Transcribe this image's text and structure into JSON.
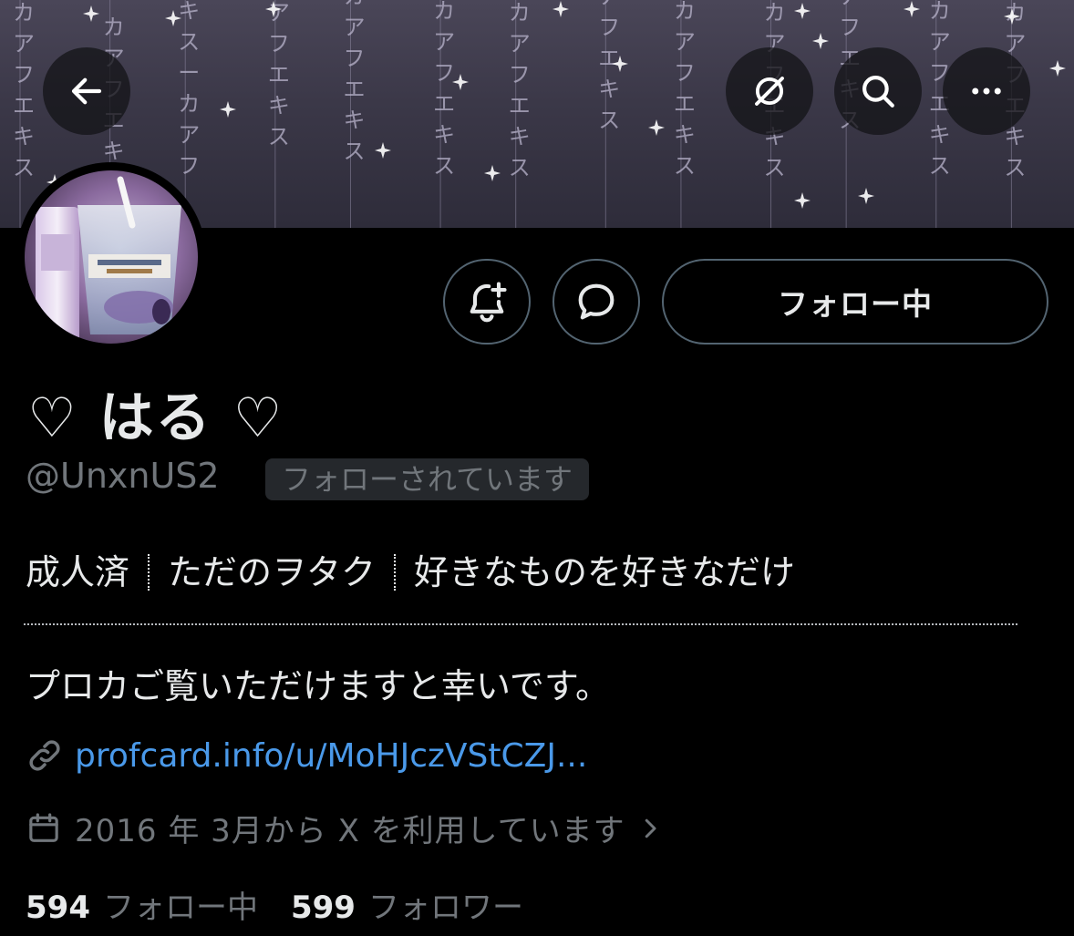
{
  "profile": {
    "display_name": "♡ はる ♡",
    "handle": "@UnxnUS2",
    "follows_you_badge": "フォローされています",
    "following_button_label": "フォロー中",
    "bio": {
      "tags": [
        "成人済",
        "ただのヲタク",
        "好きなものを好きなだけ"
      ],
      "text": "プロカご覧いただけますと幸いです。"
    },
    "link": "profcard.info/u/MoHJczVStCZJ...",
    "joined": "2016 年 3月から X を利用しています",
    "stats": {
      "following_count": "594",
      "following_label": "フォロー中",
      "followers_count": "599",
      "followers_label": "フォロワー"
    }
  },
  "banner": {
    "katakana_strings": [
      "カアフエキス",
      "ーカアフエキス",
      "エキスーカアフ",
      "アフエキス",
      "カアフエキス",
      "ーカアフエキス",
      "カアフエキス",
      "アフエキス",
      "ーカアフエキス",
      "カアフエキス",
      "アフエキス",
      "ーカアフエキス",
      "カアフエキス"
    ]
  },
  "toolbar_icons": [
    "back-arrow-icon",
    "grok-icon",
    "search-icon",
    "more-icon"
  ],
  "colors": {
    "background": "#000000",
    "text_primary": "#e7e9ea",
    "text_secondary": "#71767b",
    "link": "#4a99e9",
    "button_border": "#536471",
    "badge_bg": "#25282c"
  }
}
